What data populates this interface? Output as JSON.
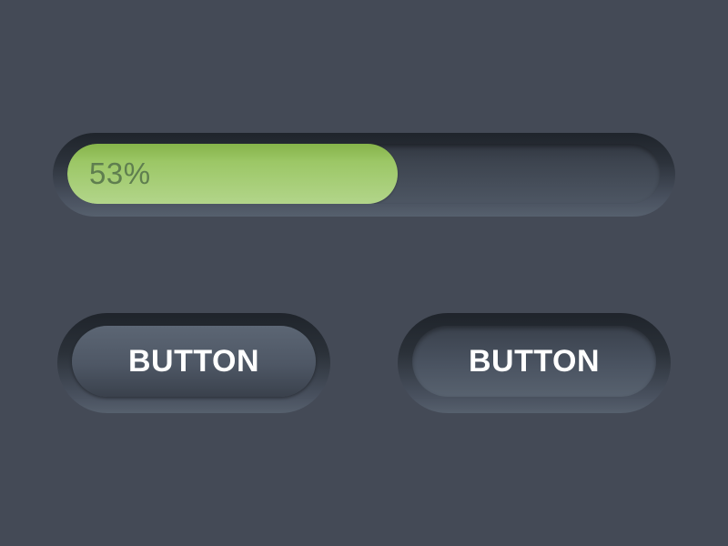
{
  "colors": {
    "background": "#444a56",
    "progress_fill": "#9cc766",
    "progress_label": "#5f7e4f",
    "button_text": "#ffffff"
  },
  "progress": {
    "value_percent": 53,
    "label": "53%"
  },
  "buttons": [
    {
      "label": "BUTTON",
      "state": "raised"
    },
    {
      "label": "BUTTON",
      "state": "pressed"
    }
  ]
}
